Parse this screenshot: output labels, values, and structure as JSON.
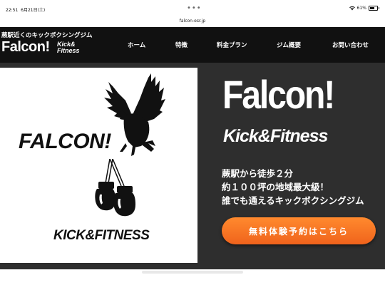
{
  "status_bar": {
    "time": "22:51",
    "date": "6月21日(土)",
    "battery": "61%"
  },
  "browser": {
    "url": "falcon-esr.jp"
  },
  "header": {
    "tagline": "蕨駅近くのキックボクシングジム",
    "logo_main": "Falcon!",
    "logo_sub_1": "Kick&",
    "logo_sub_2": "Fitness",
    "nav": [
      {
        "label": "ホーム"
      },
      {
        "label": "特徴"
      },
      {
        "label": "料金プラン"
      },
      {
        "label": "ジム概要"
      },
      {
        "label": "お問い合わせ"
      }
    ]
  },
  "hero": {
    "image": {
      "falcon_text": "FALCON!",
      "kick_text": "KICK&FITNESS"
    },
    "title": "Falcon!",
    "subtitle": "Kick&Fitness",
    "lines": [
      "蕨駅から徒歩２分",
      "約１００坪の地域最大級！",
      "誰でも通えるキックボクシングジム"
    ],
    "cta_label": "無料体験予約はこちら"
  },
  "colors": {
    "header_bg": "#111111",
    "hero_bg": "#2e2e2e",
    "cta": "#f26a1f"
  }
}
